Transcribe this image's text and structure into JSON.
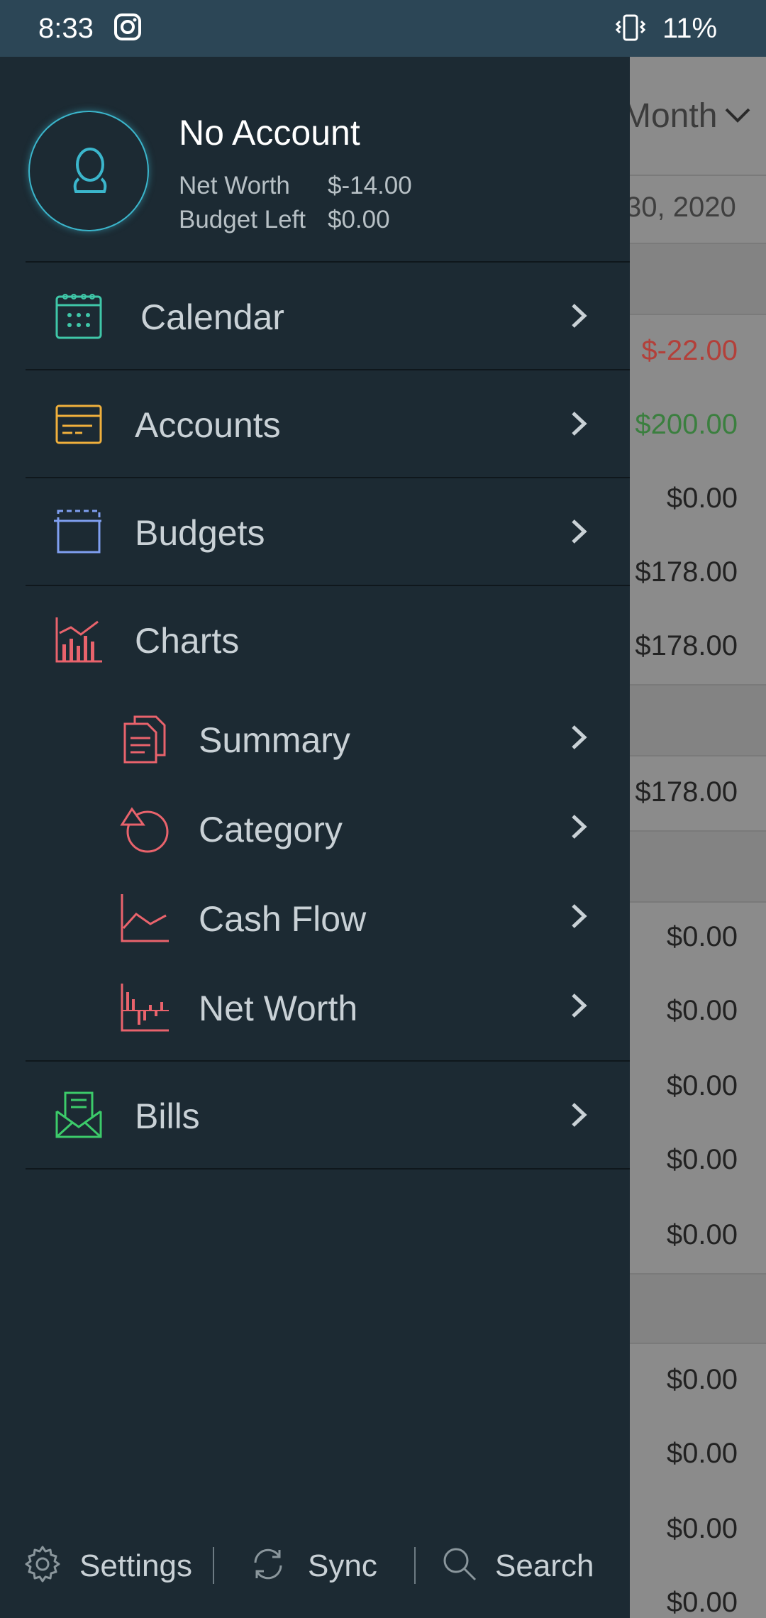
{
  "status_bar": {
    "time": "8:33",
    "battery": "11%"
  },
  "account": {
    "name": "No Account",
    "net_worth_label": "Net Worth",
    "net_worth_value": "$-14.00",
    "budget_left_label": "Budget Left",
    "budget_left_value": "$0.00"
  },
  "menu": {
    "calendar": "Calendar",
    "accounts": "Accounts",
    "budgets": "Budgets",
    "charts": "Charts",
    "summary": "Summary",
    "category": "Category",
    "cash_flow": "Cash Flow",
    "net_worth": "Net Worth",
    "bills": "Bills"
  },
  "bottom": {
    "settings": "Settings",
    "sync": "Sync",
    "search": "Search"
  },
  "background": {
    "period": "Month",
    "date": "30, 2020",
    "values": [
      "$-22.00",
      "$200.00",
      "$0.00",
      "$178.00",
      "$178.00",
      "$178.00",
      "$0.00",
      "$0.00",
      "$0.00",
      "$0.00",
      "$0.00",
      "$0.00",
      "$0.00",
      "$0.00",
      "$0.00"
    ]
  },
  "colors": {
    "drawer_bg": "#1c2a33",
    "status_bg": "#2c4656",
    "calendar_icon": "#3fc7a8",
    "accounts_icon": "#f0b03c",
    "budgets_icon": "#7f9ff0",
    "charts_icon": "#e9636c",
    "bills_icon": "#3ccb6a",
    "negative": "#b3403a",
    "positive": "#3b7f3f"
  }
}
